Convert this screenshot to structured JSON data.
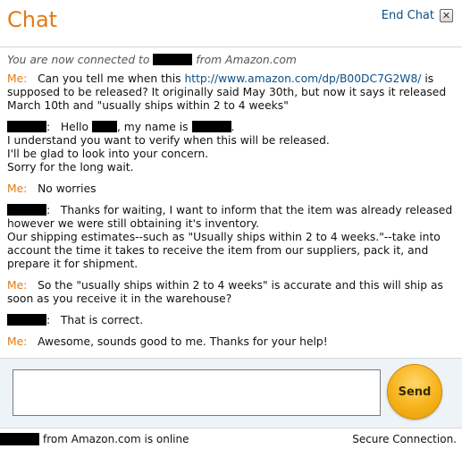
{
  "header": {
    "title": "Chat",
    "end_chat_label": "End Chat",
    "close_glyph": "✕"
  },
  "transcript": {
    "status_prefix": "You are now connected to",
    "status_suffix": "from Amazon.com",
    "me_label": "Me:",
    "agent_colon": ":",
    "m1_a": "Can you tell me when this",
    "m1_link": "http://www.amazon.com/dp/B00DC7G2W8/",
    "m1_b": "is supposed to be released? It originally said May 30th, but now it says it released March 10th and \"usually ships within 2 to 4 weeks\"",
    "m2_hello": "Hello",
    "m2_name": ", my name is",
    "m2_line2": "I understand you want to verify when this will be released.",
    "m2_line3": "I'll be glad to look into your concern.",
    "m2_line4": "Sorry for the long wait.",
    "m3": "No worries",
    "m4_a": "Thanks for waiting, I want to inform that the item was already released however we were still obtaining it's inventory.",
    "m4_b": "Our shipping estimates--such as \"Usually ships within 2 to 4 weeks.\"--take into account the time it takes to receive the item from our suppliers, pack it, and prepare it for shipment.",
    "m5": "So the \"usually ships within 2 to 4 weeks\" is accurate and this will ship as soon as you receive it in the warehouse?",
    "m6": "That is correct.",
    "m7": "Awesome, sounds good to me. Thanks for your help!"
  },
  "input": {
    "message_value": "",
    "send_label": "Send"
  },
  "footer": {
    "online_text": "from Amazon.com is online",
    "secure_text": "Secure Connection."
  },
  "colors": {
    "accent_orange": "#e47911",
    "link_blue": "#0b4f8a",
    "send_button": "#f7b21b"
  }
}
